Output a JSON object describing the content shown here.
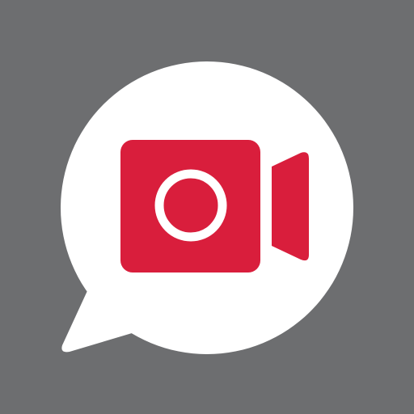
{
  "icon": {
    "name": "video-chat-app-icon",
    "colors": {
      "background": "#6d6e70",
      "bubble": "#ffffff",
      "camera": "#d91e3c",
      "lens": "#ffffff"
    }
  }
}
